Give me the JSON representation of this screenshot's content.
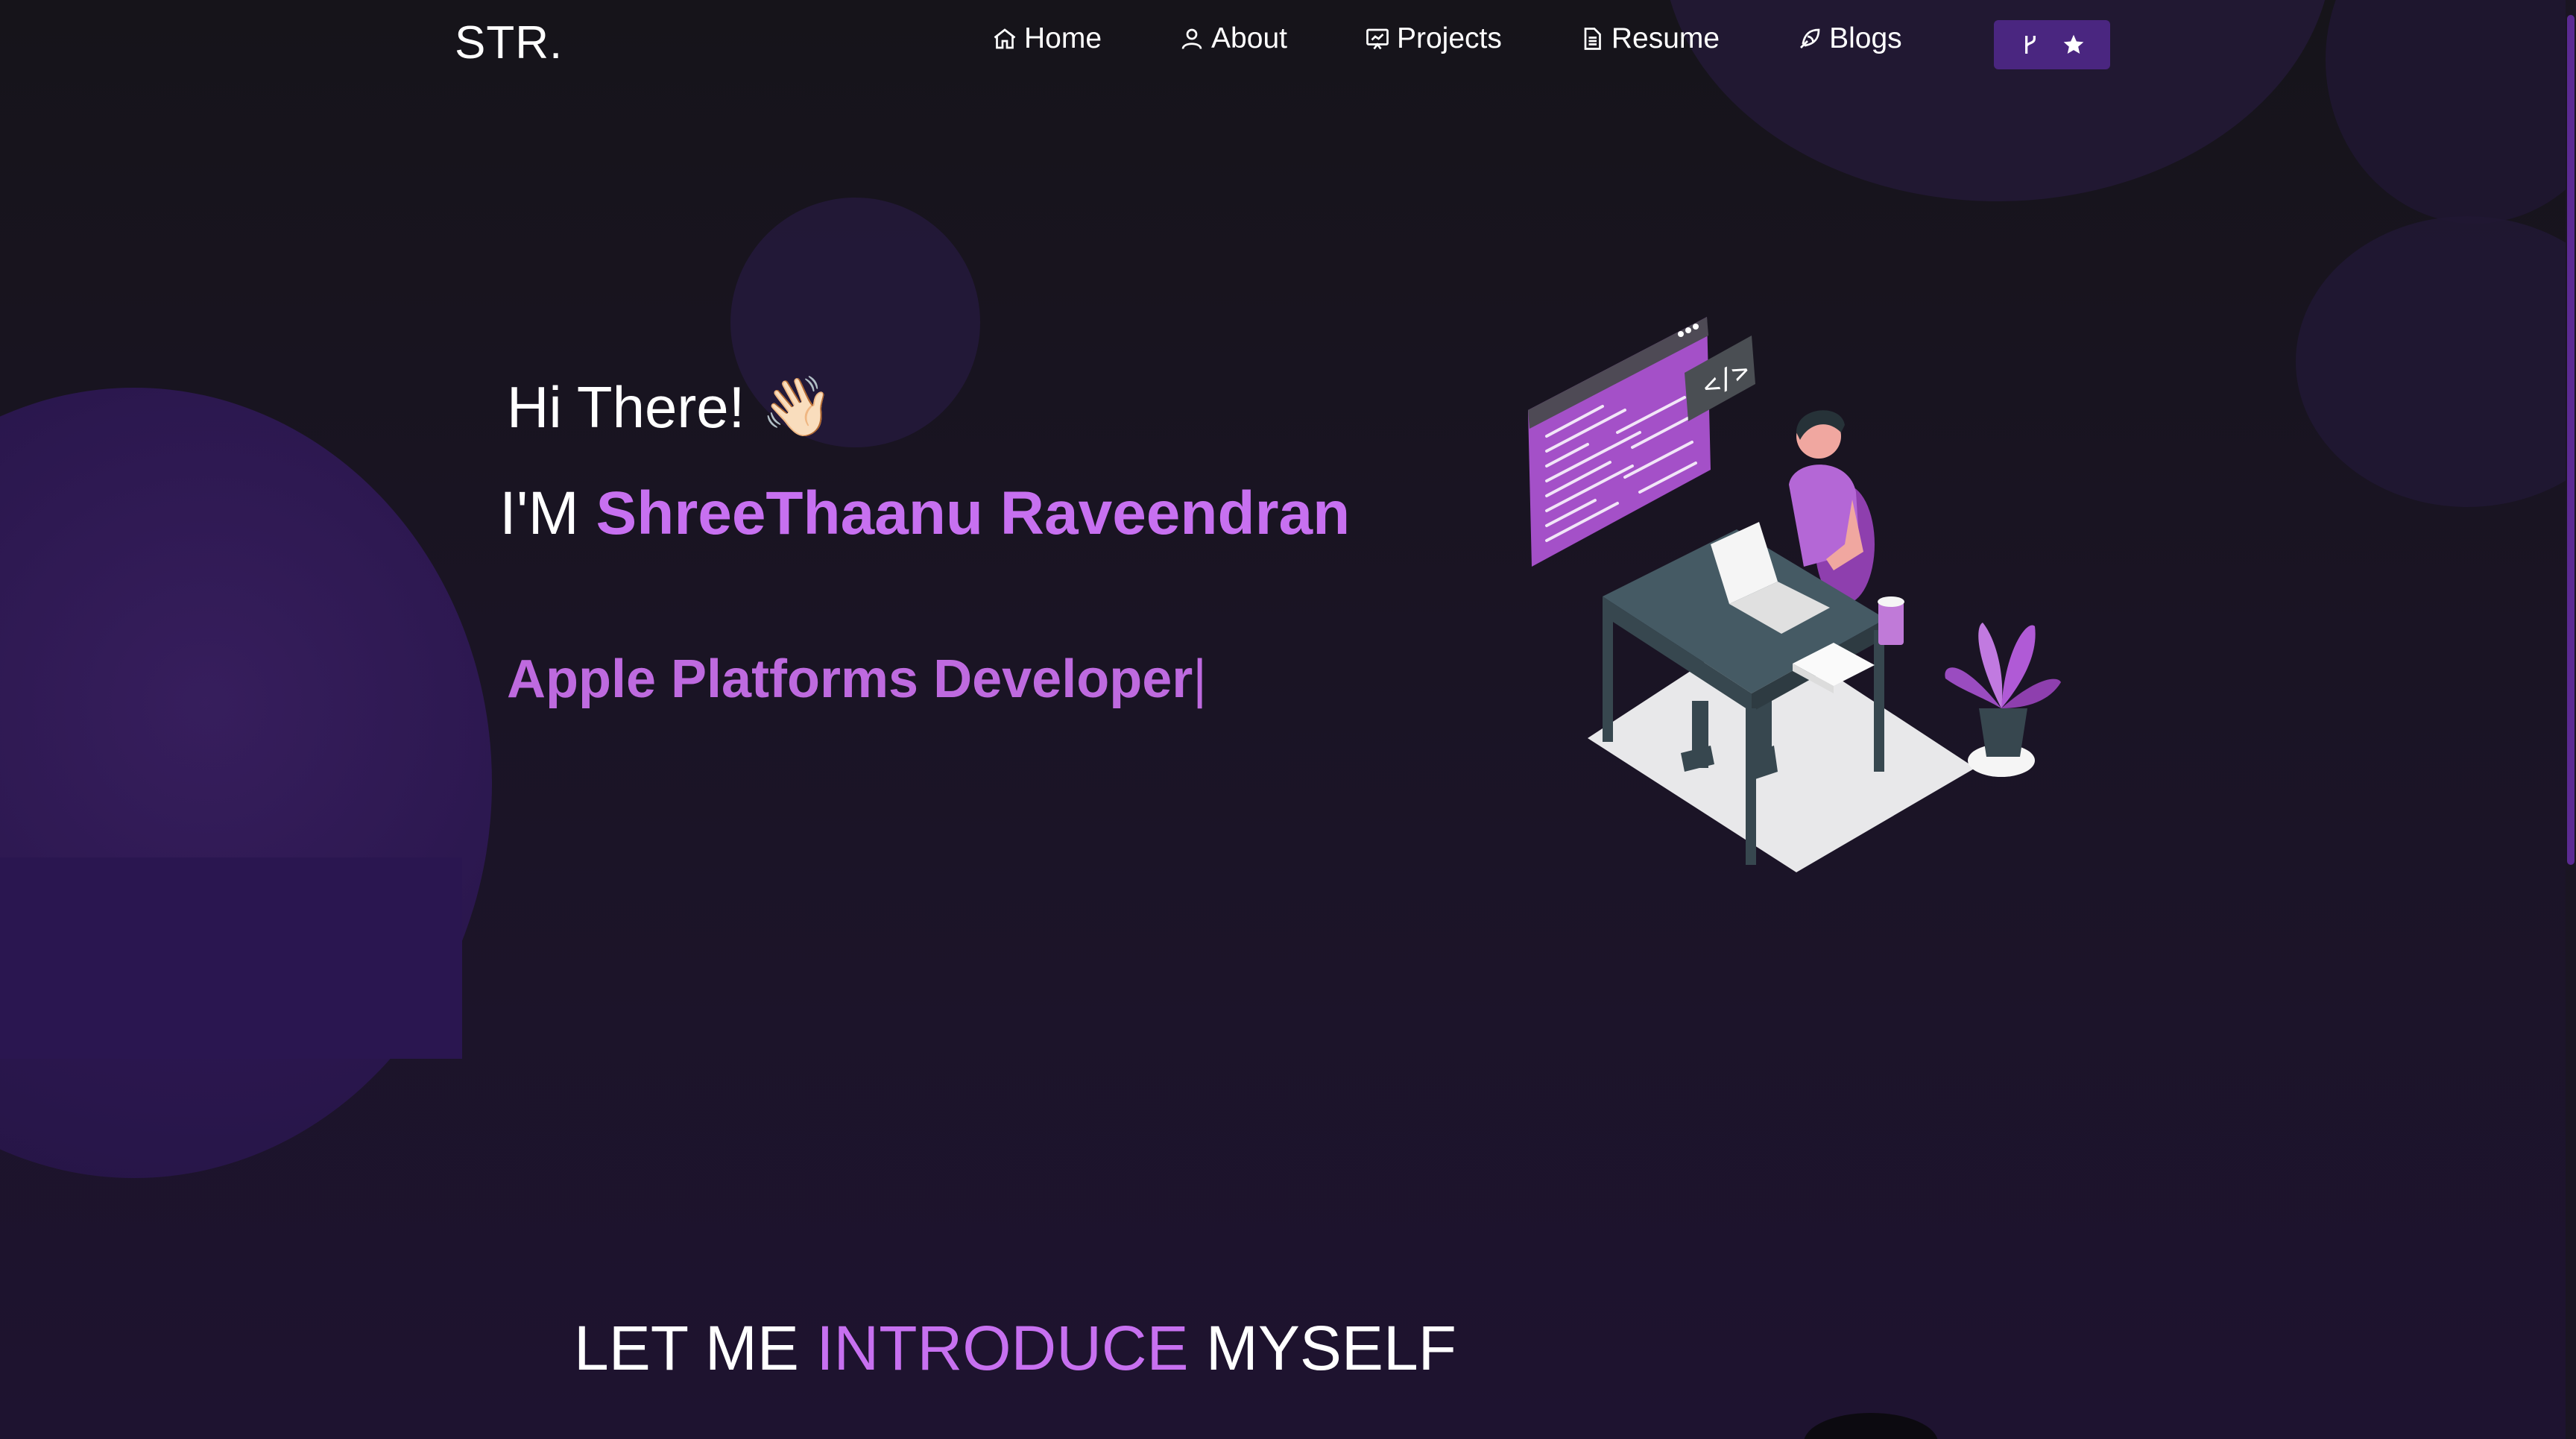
{
  "brand": "STR.",
  "nav": {
    "items": [
      {
        "label": "Home",
        "icon": "home-icon"
      },
      {
        "label": "About",
        "icon": "user-icon"
      },
      {
        "label": "Projects",
        "icon": "projects-icon"
      },
      {
        "label": "Resume",
        "icon": "document-icon"
      },
      {
        "label": "Blogs",
        "icon": "blog-icon"
      }
    ],
    "fork_button": {
      "icons": [
        "git-fork-icon",
        "star-icon"
      ]
    }
  },
  "hero": {
    "greeting": "Hi There!",
    "wave_emoji": "👋🏻",
    "im_prefix": "I'M ",
    "name": "ShreeThaanu Raveendran",
    "role": "Apple Platforms Developer",
    "cursor": "|"
  },
  "intro": {
    "part1": "LET ME ",
    "accent": "INTRODUCE",
    "part2": " MYSELF"
  },
  "colors": {
    "accent": "#c770f0",
    "background": "#1a1424",
    "button": "#4a2680"
  }
}
